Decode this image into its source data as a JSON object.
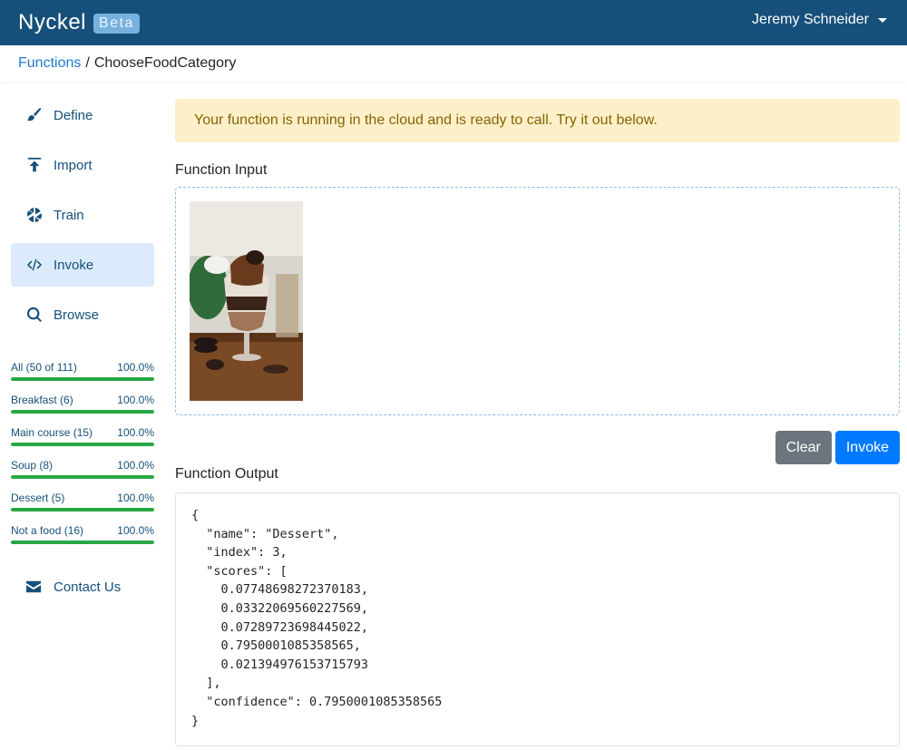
{
  "navbar": {
    "brand": "Nyckel",
    "badge": "Beta",
    "user": "Jeremy Schneider",
    "colors": {
      "background": "#16507a"
    }
  },
  "breadcrumb": {
    "parent": "Functions",
    "separator": "/",
    "current": "ChooseFoodCategory"
  },
  "sidebar": {
    "items": [
      {
        "label": "Define",
        "icon": "paintbrush-icon",
        "active": false
      },
      {
        "label": "Import",
        "icon": "upload-icon",
        "active": false
      },
      {
        "label": "Train",
        "icon": "aperture-icon",
        "active": false
      },
      {
        "label": "Invoke",
        "icon": "code-icon",
        "active": true
      },
      {
        "label": "Browse",
        "icon": "search-icon",
        "active": false
      }
    ],
    "stats": [
      {
        "label": "All (50 of 111)",
        "percent_label": "100.0%",
        "progress": 1.0
      },
      {
        "label": "Breakfast (6)",
        "percent_label": "100.0%",
        "progress": 1.0
      },
      {
        "label": "Main course (15)",
        "percent_label": "100.0%",
        "progress": 1.0
      },
      {
        "label": "Soup (8)",
        "percent_label": "100.0%",
        "progress": 1.0
      },
      {
        "label": "Dessert (5)",
        "percent_label": "100.0%",
        "progress": 1.0
      },
      {
        "label": "Not a food (16)",
        "percent_label": "100.0%",
        "progress": 1.0
      }
    ],
    "contact": "Contact Us"
  },
  "main": {
    "alert": "Your function is running in the cloud and is ready to call. Try it out below.",
    "input_label": "Function Input",
    "input_image": "dessert-parfait-photo",
    "buttons": {
      "clear": "Clear",
      "invoke": "Invoke"
    },
    "output_label": "Function Output",
    "output": {
      "name": "Dessert",
      "index": 3,
      "scores": [
        "0.07748698272370183",
        "0.03322069560227569",
        "0.07289723698445022",
        "0.7950001085358565",
        "0.021394976153715793"
      ],
      "confidence": "0.7950001085358565"
    }
  }
}
